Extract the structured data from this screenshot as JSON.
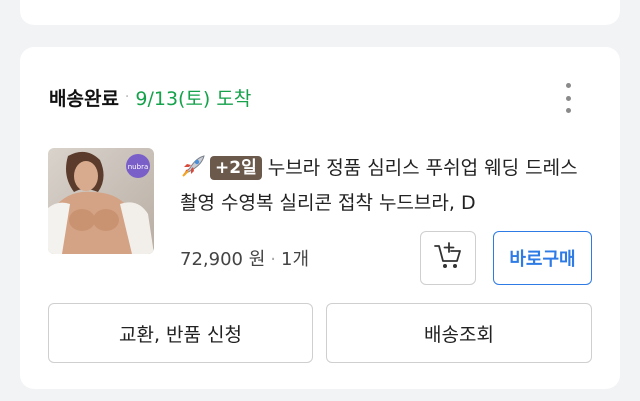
{
  "order": {
    "status_label": "배송완료",
    "separator": "·",
    "delivery_date": "9/13(토) 도착",
    "status_color": "#15a24b"
  },
  "product": {
    "badge": "+2일",
    "title_line1": "누브라 정품 심리스 푸쉬업 웨딩 드레스",
    "title_line2": "촬영 수영복 실리콘 접착 누드브라, D",
    "price": "72,900 원",
    "separator": "·",
    "quantity": "1개",
    "thumbnail_logo": "nubra"
  },
  "actions": {
    "buy_now": "바로구매",
    "exchange_return": "교환, 반품 신청",
    "track_delivery": "배송조회"
  },
  "colors": {
    "accent_blue": "#2e7be6",
    "badge_brown": "#6b5a4c"
  },
  "icons": {
    "more": "more-vertical-icon",
    "rocket": "rocket-icon",
    "cart": "add-to-cart-icon"
  }
}
